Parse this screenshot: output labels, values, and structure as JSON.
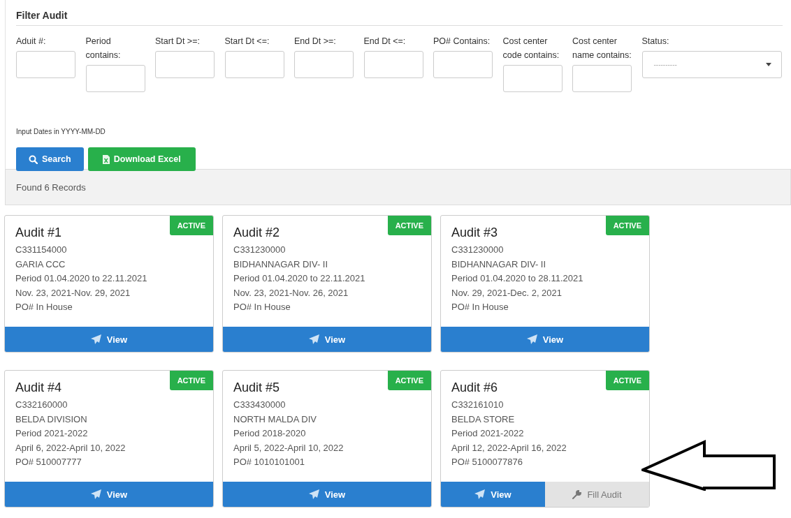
{
  "filter": {
    "title": "Filter Audit",
    "fields": [
      {
        "label": "Aduit #:",
        "kind": "text"
      },
      {
        "label": "Period contains:",
        "kind": "text"
      },
      {
        "label": "Start Dt >=:",
        "kind": "text"
      },
      {
        "label": "Start Dt <=:",
        "kind": "text"
      },
      {
        "label": "End Dt >=:",
        "kind": "text"
      },
      {
        "label": "End Dt <=:",
        "kind": "text"
      },
      {
        "label": "PO# Contains:",
        "kind": "text"
      },
      {
        "label": "Cost center code contains:",
        "kind": "text"
      },
      {
        "label": "Cost center name contains:",
        "kind": "text"
      },
      {
        "label": "Status:",
        "kind": "select",
        "placeholder": "----------"
      }
    ],
    "note": "Input Dates in YYYY-MM-DD",
    "buttons": [
      {
        "label": "Search",
        "kind": "search"
      },
      {
        "label": "Download Excel",
        "kind": "excel"
      }
    ]
  },
  "result_count": "Found 6 Records",
  "cards": [
    {
      "title": "Audit #1",
      "status": "ACTIVE",
      "lines": [
        "C331154000",
        "GARIA CCC",
        "Period 01.04.2020 to 22.11.2021",
        "Nov. 23, 2021-Nov. 29, 2021",
        "PO# In House"
      ],
      "actions": [
        {
          "label": "View",
          "kind": "view"
        }
      ]
    },
    {
      "title": "Audit #2",
      "status": "ACTIVE",
      "lines": [
        "C331230000",
        "BIDHANNAGAR DIV- II",
        "Period 01.04.2020 to 22.11.2021",
        "Nov. 23, 2021-Nov. 26, 2021",
        "PO# In House"
      ],
      "actions": [
        {
          "label": "View",
          "kind": "view"
        }
      ]
    },
    {
      "title": "Audit #3",
      "status": "ACTIVE",
      "lines": [
        "C331230000",
        "BIDHANNAGAR DIV- II",
        "Period 01.04.2020 to 28.11.2021",
        "Nov. 29, 2021-Dec. 2, 2021",
        "PO# In House"
      ],
      "actions": [
        {
          "label": "View",
          "kind": "view"
        }
      ]
    },
    {
      "title": "Audit #4",
      "status": "ACTIVE",
      "lines": [
        "C332160000",
        "BELDA DIVISION",
        "Period 2021-2022",
        "April 6, 2022-April 10, 2022",
        "PO# 510007777"
      ],
      "actions": [
        {
          "label": "View",
          "kind": "view"
        }
      ]
    },
    {
      "title": "Audit #5",
      "status": "ACTIVE",
      "lines": [
        "C333430000",
        "NORTH MALDA DIV",
        "Period 2018-2020",
        "April 5, 2022-April 10, 2022",
        "PO# 1010101001"
      ],
      "actions": [
        {
          "label": "View",
          "kind": "view"
        }
      ]
    },
    {
      "title": "Audit #6",
      "status": "ACTIVE",
      "lines": [
        "C332161010",
        "BELDA STORE",
        "Period 2021-2022",
        "April 12, 2022-April 16, 2022",
        "PO# 5100077876"
      ],
      "actions": [
        {
          "label": "View",
          "kind": "view"
        },
        {
          "label": "Fill Audit",
          "kind": "fill"
        }
      ]
    }
  ]
}
